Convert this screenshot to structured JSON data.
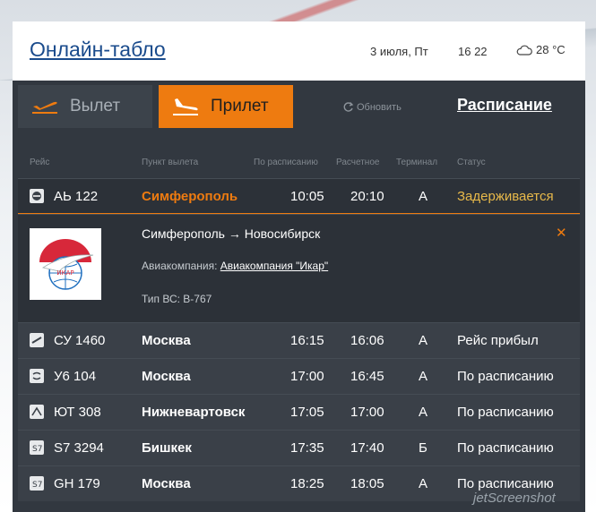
{
  "header": {
    "title": "Онлайн-табло",
    "date": "3 июля, Пт",
    "time": "16 22",
    "temperature": "28 °C"
  },
  "tabs": {
    "departure": "Вылет",
    "arrival": "Прилет"
  },
  "refresh_label": "Обновить",
  "schedule_label": "Расписание",
  "columns": [
    "Рейс",
    "Пункт вылета",
    "По расписанию",
    "Расчетное",
    "Терминал",
    "Статус"
  ],
  "flights": [
    {
      "flight": "АЬ 122",
      "city": "Симферополь",
      "planned": "10:05",
      "estimated": "20:10",
      "terminal": "A",
      "status": "Задерживается"
    },
    {
      "flight": "СУ 1460",
      "city": "Москва",
      "planned": "16:15",
      "estimated": "16:06",
      "terminal": "A",
      "status": "Рейс прибыл"
    },
    {
      "flight": "У6 104",
      "city": "Москва",
      "planned": "17:00",
      "estimated": "16:45",
      "terminal": "A",
      "status": "По расписанию"
    },
    {
      "flight": "ЮТ 308",
      "city": "Нижневартовск",
      "planned": "17:05",
      "estimated": "17:00",
      "terminal": "A",
      "status": "По расписанию"
    },
    {
      "flight": "S7 3294",
      "city": "Бишкек",
      "planned": "17:35",
      "estimated": "17:40",
      "terminal": "Б",
      "status": "По расписанию"
    },
    {
      "flight": "GH 179",
      "city": "Москва",
      "planned": "18:25",
      "estimated": "18:05",
      "terminal": "A",
      "status": "По расписанию"
    }
  ],
  "detail": {
    "route": "Симферополь → Новосибирск",
    "airline_label": "Авиакомпания:",
    "airline_name": "Авиакомпания \"Икар\"",
    "aircraft": "Тип ВС: B-767",
    "logo_text": "ИКАР"
  },
  "watermark": "jetScreenshot",
  "colors": {
    "accent": "#ee7b10",
    "panel": "#323840",
    "title": "#1a4b8c"
  }
}
